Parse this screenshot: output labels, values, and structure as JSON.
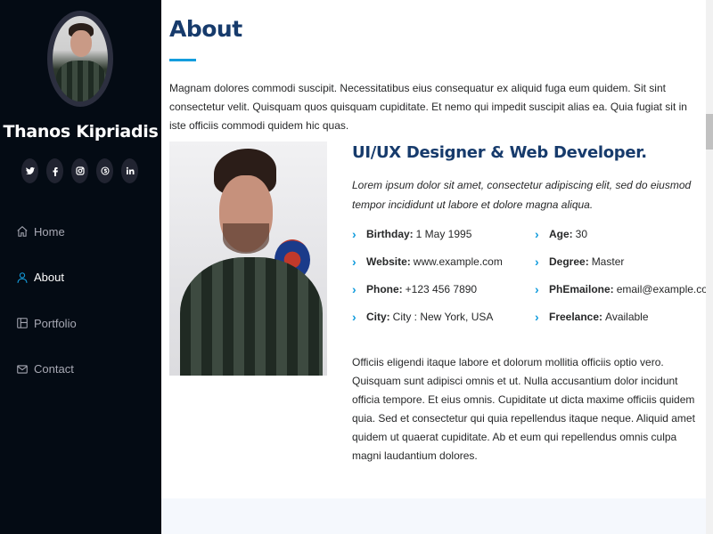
{
  "sidebar": {
    "name": "Thanos Kipriadis",
    "social": [
      {
        "icon": "twitter-icon",
        "glyph": ""
      },
      {
        "icon": "facebook-icon",
        "glyph": "f"
      },
      {
        "icon": "instagram-icon",
        "glyph": ""
      },
      {
        "icon": "skype-icon",
        "glyph": ""
      },
      {
        "icon": "linkedin-icon",
        "glyph": "in"
      }
    ],
    "nav": [
      {
        "label": "Home",
        "icon": "home-icon"
      },
      {
        "label": "About",
        "icon": "user-icon",
        "active": true
      },
      {
        "label": "Portfolio",
        "icon": "portfolio-icon"
      },
      {
        "label": "Contact",
        "icon": "envelope-icon"
      }
    ]
  },
  "about": {
    "title": "About",
    "intro": "Magnam dolores commodi suscipit. Necessitatibus eius consequatur ex aliquid fuga eum quidem. Sit sint consectetur velit. Quisquam quos quisquam cupiditate. Et nemo qui impedit suscipit alias ea. Quia fugiat sit in iste officiis commodi quidem hic quas.",
    "role": "UI/UX Designer & Web Developer.",
    "role_desc": "Lorem ipsum dolor sit amet, consectetur adipiscing elit, sed do eiusmod tempor incididunt ut labore et dolore magna aliqua.",
    "facts_left": [
      {
        "label": "Birthday:",
        "value": "1 May 1995"
      },
      {
        "label": "Website:",
        "value": "www.example.com"
      },
      {
        "label": "Phone:",
        "value": "+123 456 7890"
      },
      {
        "label": "City:",
        "value": "City : New York, USA"
      }
    ],
    "facts_right": [
      {
        "label": "Age:",
        "value": "30"
      },
      {
        "label": "Degree:",
        "value": "Master"
      },
      {
        "label": "PhEmailone:",
        "value": "email@example.com"
      },
      {
        "label": "Freelance:",
        "value": "Available"
      }
    ],
    "outro": "Officiis eligendi itaque labore et dolorum mollitia officiis optio vero. Quisquam sunt adipisci omnis et ut. Nulla accusantium dolor incidunt officia tempore. Et eius omnis. Cupiditate ut dicta maxime officiis quidem quia. Sed et consectetur qui quia repellendus itaque neque. Aliquid amet quidem ut quaerat cupiditate. Ab et eum qui repellendus omnis culpa magni laudantium dolores."
  },
  "colors": {
    "sidebar_bg": "#040b14",
    "accent": "#149ddd",
    "heading": "#173b6c",
    "text": "#272829"
  }
}
